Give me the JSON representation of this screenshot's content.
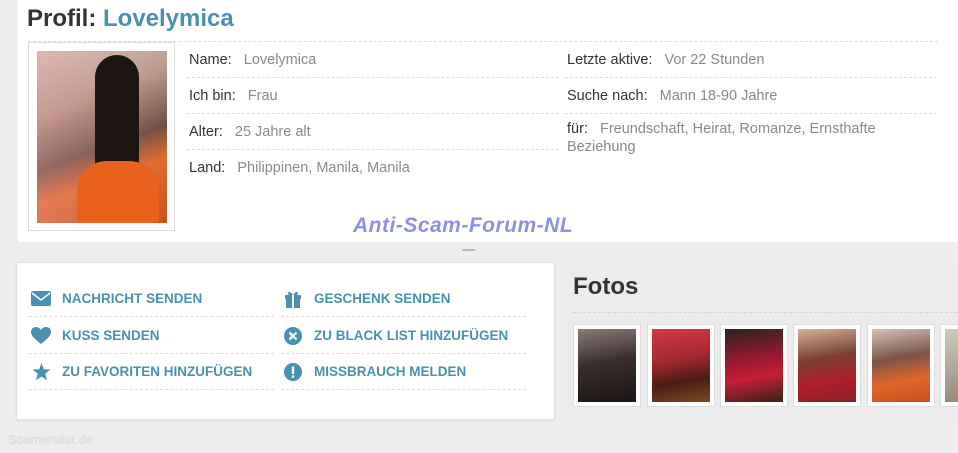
{
  "profile": {
    "title_prefix": "Profil:",
    "name": "Lovelymica"
  },
  "fields_left": [
    {
      "label": "Name:",
      "value": "Lovelymica"
    },
    {
      "label": "Ich bin:",
      "value": "Frau"
    },
    {
      "label": "Alter:",
      "value": "25 Jahre alt"
    },
    {
      "label": "Land:",
      "value": "Philippinen, Manila, Manila"
    }
  ],
  "fields_right": [
    {
      "label": "Letzte aktive:",
      "value": "Vor 22 Stunden"
    },
    {
      "label": "Suche nach:",
      "value": "Mann 18-90 Jahre"
    },
    {
      "label": "für:",
      "value": "Freundschaft, Heirat, Romanze, Ernsthafte Beziehung"
    }
  ],
  "watermark": "Anti-Scam-Forum-NL",
  "actions": {
    "send_message": "NACHRICHT SENDEN",
    "send_kiss": "KUSS SENDEN",
    "add_favorites": "ZU FAVORITEN HINZUFÜGEN",
    "send_gift": "GESCHENK SENDEN",
    "add_blacklist": "ZU BLACK LIST HINZUFÜGEN",
    "report_abuse": "MISSBRAUCH MELDEN"
  },
  "icons": {
    "send_message": "envelope-icon",
    "send_kiss": "heart-icon",
    "add_favorites": "star-icon",
    "send_gift": "gift-icon",
    "add_blacklist": "close-circle-icon",
    "report_abuse": "exclamation-circle-icon"
  },
  "colors": {
    "accent": "#4a90b0",
    "background": "#eeeeee",
    "watermark": "#8f8fe8"
  },
  "photos": {
    "title": "Fotos",
    "count_visible": 6
  },
  "site_mark": "Scamerslist.de"
}
